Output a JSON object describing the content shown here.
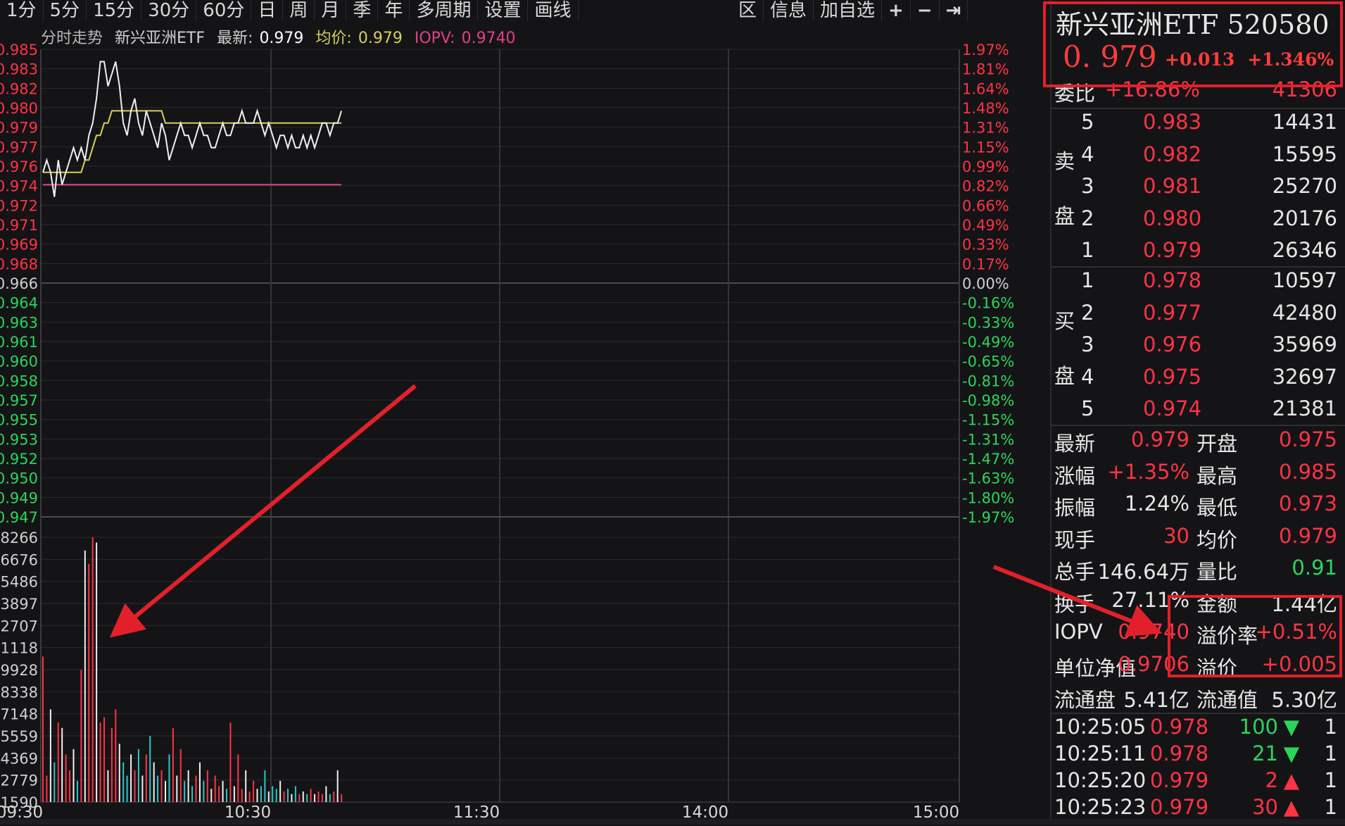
{
  "toolbar": {
    "left_items": [
      "1分",
      "5分",
      "15分",
      "30分",
      "60分",
      "日",
      "周",
      "月",
      "季",
      "年",
      "多周期",
      "设置",
      "画线"
    ],
    "right_items": [
      "区",
      "信息",
      "加自选"
    ],
    "icons": [
      "plus-icon",
      "minus-icon",
      "exit-icon"
    ]
  },
  "legend": {
    "label": "分时走势",
    "name": "新兴亚洲ETF",
    "latest_label": "最新:",
    "latest_value": "0.979",
    "avg_label": "均价:",
    "avg_value": "0.979",
    "iopv_label": "IOPV:",
    "iopv_value": "0.9740"
  },
  "chart_data": {
    "type": "line",
    "left_price_ticks": [
      "0.985",
      "0.983",
      "0.982",
      "0.980",
      "0.979",
      "0.977",
      "0.976",
      "0.974",
      "0.972",
      "0.971",
      "0.969",
      "0.968",
      "0.966",
      "0.964",
      "0.963",
      "0.961",
      "0.960",
      "0.958",
      "0.957",
      "0.955",
      "0.953",
      "0.952",
      "0.950",
      "0.949",
      "0.947"
    ],
    "right_pct_ticks": [
      "1.97%",
      "1.81%",
      "1.64%",
      "1.48%",
      "1.31%",
      "1.15%",
      "0.99%",
      "0.82%",
      "0.66%",
      "0.49%",
      "0.33%",
      "0.17%",
      "0.00%",
      "-0.16%",
      "-0.33%",
      "-0.49%",
      "-0.65%",
      "-0.81%",
      "-0.98%",
      "-1.15%",
      "-1.31%",
      "-1.47%",
      "-1.63%",
      "-1.80%",
      "-1.97%"
    ],
    "volume_ticks": [
      "8266",
      "6676",
      "5486",
      "3897",
      "2707",
      "1118",
      "9928",
      "8338",
      "7148",
      "5559",
      "4369",
      "2779",
      "1590"
    ],
    "time_ticks": [
      "09:30",
      "10:30",
      "11:30",
      "14:00",
      "15:00"
    ],
    "ylim": [
      0.947,
      0.985
    ],
    "prev_close": 0.966,
    "iopv_level": 0.974,
    "price_series": [
      0.975,
      0.976,
      0.975,
      0.973,
      0.976,
      0.974,
      0.975,
      0.976,
      0.977,
      0.976,
      0.977,
      0.976,
      0.978,
      0.979,
      0.981,
      0.984,
      0.984,
      0.982,
      0.983,
      0.984,
      0.982,
      0.979,
      0.978,
      0.98,
      0.981,
      0.979,
      0.978,
      0.98,
      0.979,
      0.978,
      0.977,
      0.979,
      0.978,
      0.976,
      0.977,
      0.978,
      0.979,
      0.978,
      0.978,
      0.977,
      0.978,
      0.979,
      0.978,
      0.978,
      0.977,
      0.977,
      0.978,
      0.979,
      0.978,
      0.978,
      0.979,
      0.979,
      0.98,
      0.979,
      0.979,
      0.979,
      0.98,
      0.979,
      0.978,
      0.979,
      0.978,
      0.977,
      0.978,
      0.978,
      0.977,
      0.978,
      0.977,
      0.977,
      0.978,
      0.977,
      0.978,
      0.977,
      0.978,
      0.979,
      0.979,
      0.978,
      0.979,
      0.979,
      0.98
    ],
    "avg_series": [
      0.975,
      0.975,
      0.975,
      0.975,
      0.975,
      0.975,
      0.975,
      0.975,
      0.975,
      0.975,
      0.975,
      0.976,
      0.976,
      0.977,
      0.978,
      0.978,
      0.979,
      0.979,
      0.98,
      0.98,
      0.98,
      0.98,
      0.98,
      0.98,
      0.98,
      0.98,
      0.98,
      0.98,
      0.98,
      0.98,
      0.98,
      0.98,
      0.979,
      0.979,
      0.979,
      0.979,
      0.979,
      0.979,
      0.979,
      0.979,
      0.979,
      0.979,
      0.979,
      0.979,
      0.979,
      0.979,
      0.979,
      0.979,
      0.979,
      0.979,
      0.979,
      0.979,
      0.979,
      0.979,
      0.979,
      0.979,
      0.979,
      0.979,
      0.979,
      0.979,
      0.979,
      0.979,
      0.979,
      0.979,
      0.979,
      0.979,
      0.979,
      0.979,
      0.979,
      0.979,
      0.979,
      0.979,
      0.979,
      0.979,
      0.979,
      0.979,
      0.979,
      0.979,
      0.979
    ],
    "volume_series": [
      0.55,
      0.1,
      0.35,
      0.15,
      0.3,
      0.28,
      0.18,
      0.12,
      0.2,
      0.08,
      0.5,
      0.95,
      0.9,
      1.0,
      0.98,
      0.3,
      0.32,
      0.12,
      0.28,
      0.35,
      0.22,
      0.15,
      0.1,
      0.18,
      0.12,
      0.2,
      0.1,
      0.18,
      0.25,
      0.15,
      0.1,
      0.12,
      0.08,
      0.18,
      0.28,
      0.1,
      0.2,
      0.08,
      0.12,
      0.06,
      0.1,
      0.15,
      0.08,
      0.12,
      0.05,
      0.1,
      0.06,
      0.08,
      0.05,
      0.3,
      0.06,
      0.18,
      0.05,
      0.12,
      0.04,
      0.08,
      0.05,
      0.06,
      0.12,
      0.04,
      0.06,
      0.05,
      0.08,
      0.04,
      0.05,
      0.03,
      0.06,
      0.03,
      0.04,
      0.03,
      0.05,
      0.03,
      0.04,
      0.03,
      0.06,
      0.03,
      0.04,
      0.12,
      0.03
    ],
    "session_minutes": 240,
    "elapsed_minutes": 79
  },
  "panel": {
    "name": "新兴亚洲ETF 520580",
    "price": "0. 979",
    "change": "+0.013",
    "change_pct": "+1.346%",
    "weibi_label": "委比",
    "weibi_value": "+16.86%",
    "weibi_diff": "41306",
    "sell_label_1": "卖",
    "sell_label_2": "盘",
    "buy_label_1": "买",
    "buy_label_2": "盘",
    "asks": [
      {
        "level": "5",
        "price": "0.983",
        "vol": "14431"
      },
      {
        "level": "4",
        "price": "0.982",
        "vol": "15595"
      },
      {
        "level": "3",
        "price": "0.981",
        "vol": "25270"
      },
      {
        "level": "2",
        "price": "0.980",
        "vol": "20176"
      },
      {
        "level": "1",
        "price": "0.979",
        "vol": "26346"
      }
    ],
    "bids": [
      {
        "level": "1",
        "price": "0.978",
        "vol": "10597"
      },
      {
        "level": "2",
        "price": "0.977",
        "vol": "42480"
      },
      {
        "level": "3",
        "price": "0.976",
        "vol": "35969"
      },
      {
        "level": "4",
        "price": "0.975",
        "vol": "32697"
      },
      {
        "level": "5",
        "price": "0.974",
        "vol": "21381"
      }
    ],
    "stats": [
      {
        "l1": "最新",
        "v1": "0.979",
        "c1": "red",
        "l2": "开盘",
        "v2": "0.975",
        "c2": "red"
      },
      {
        "l1": "涨幅",
        "v1": "+1.35%",
        "c1": "red",
        "l2": "最高",
        "v2": "0.985",
        "c2": "red"
      },
      {
        "l1": "振幅",
        "v1": "1.24%",
        "c1": "white",
        "l2": "最低",
        "v2": "0.973",
        "c2": "red"
      },
      {
        "l1": "现手",
        "v1": "30",
        "c1": "red",
        "l2": "均价",
        "v2": "0.979",
        "c2": "red"
      },
      {
        "l1": "总手",
        "v1": "146.64万",
        "c1": "white",
        "l2": "量比",
        "v2": "0.91",
        "c2": "green"
      },
      {
        "l1": "换手",
        "v1": "27.11%",
        "c1": "white",
        "l2": "金额",
        "v2": "1.44亿",
        "c2": "white"
      },
      {
        "l1": "IOPV",
        "v1": "0.9740",
        "c1": "red",
        "l2": "溢价率",
        "v2": "+0.51%",
        "c2": "red"
      },
      {
        "l1": "单位净值",
        "v1": "0.9706",
        "c1": "red",
        "l2": "溢价",
        "v2": "+0.005",
        "c2": "red"
      },
      {
        "l1": "流通盘",
        "v1": "5.41亿",
        "c1": "white",
        "l2": "流通值",
        "v2": "5.30亿",
        "c2": "white"
      }
    ],
    "ticks": [
      {
        "time": "10:25:05",
        "price": "0.978",
        "vol": "100",
        "dir": "down",
        "n": "1"
      },
      {
        "time": "10:25:11",
        "price": "0.978",
        "vol": "21",
        "dir": "down",
        "n": "1"
      },
      {
        "time": "10:25:20",
        "price": "0.979",
        "vol": "2",
        "dir": "up",
        "n": "1"
      },
      {
        "time": "10:25:23",
        "price": "0.979",
        "vol": "30",
        "dir": "up",
        "n": "1"
      }
    ]
  }
}
